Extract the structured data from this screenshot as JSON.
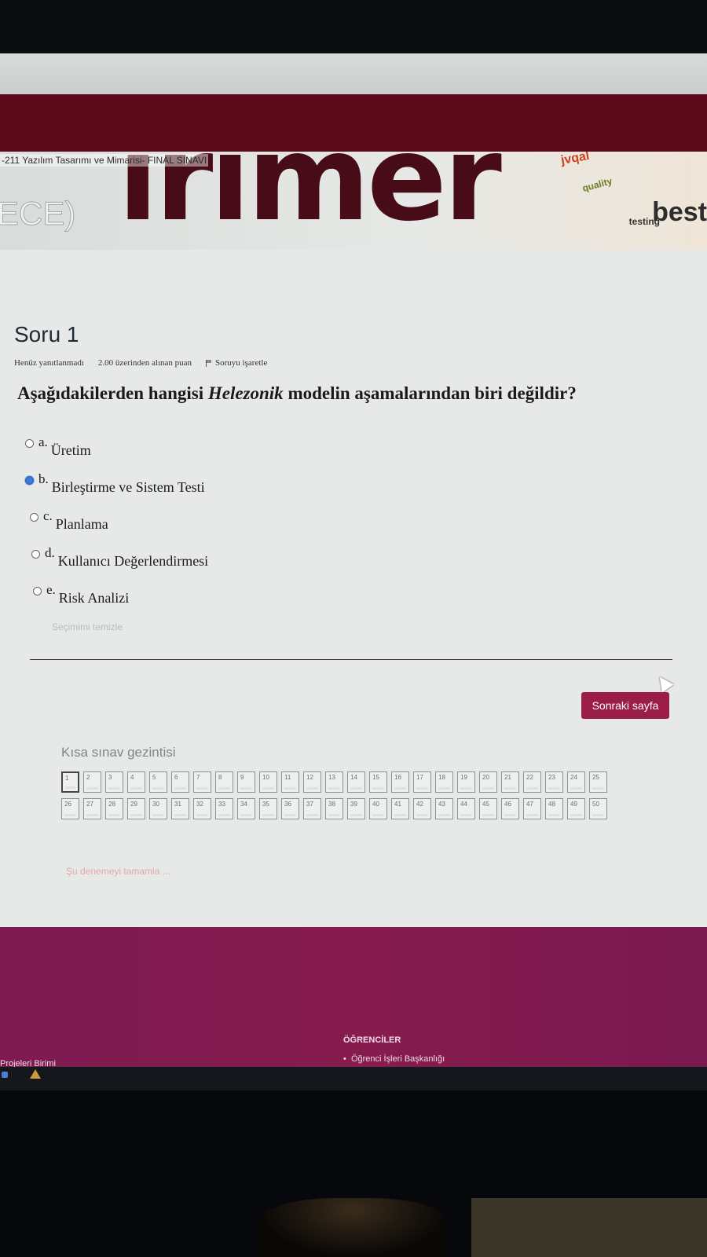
{
  "banner": {
    "breadcrumb": "-211 Yazılım Tasarımı ve Mimarisi- FINAL SINAVI",
    "big_text": "ırımer",
    "left_text": "ECE)",
    "cloud_words": [
      "best",
      "jvqal",
      "quality",
      "testing"
    ]
  },
  "question": {
    "title": "Soru 1",
    "status": "Henüz yanıtlanmadı",
    "points": "2.00 üzerinden alınan puan",
    "flag_label": "Soruyu işaretle",
    "text_before": "Aşağıdakilerden hangisi ",
    "text_emph": "Helezonik",
    "text_after": " modelin aşamalarından biri değildir?",
    "options": [
      {
        "letter": "a.",
        "text": "Üretim",
        "selected": false
      },
      {
        "letter": "b.",
        "text": "Birleştirme ve Sistem Testi",
        "selected": true
      },
      {
        "letter": "c.",
        "text": "Planlama",
        "selected": false
      },
      {
        "letter": "d.",
        "text": "Kullanıcı Değerlendirmesi",
        "selected": false
      },
      {
        "letter": "e.",
        "text": "Risk Analizi",
        "selected": false
      }
    ],
    "clear_selection": "Seçimimi temizle"
  },
  "next_button": "Sonraki sayfa",
  "quiz_nav": {
    "title": "Kısa sınav gezintisi",
    "count": 50,
    "current": 1,
    "finish_link": "Şu denemeyi tamamla ..."
  },
  "footer": {
    "heading": "ÖĞRENCİLER",
    "item": "Öğrenci İşleri Başkanlığı",
    "left_text": "Projeleri Birimi"
  },
  "colors": {
    "accent": "#9c1c48",
    "footer": "#861b4e",
    "banner_text": "#470c17",
    "selected_radio": "#3a7bd5"
  }
}
